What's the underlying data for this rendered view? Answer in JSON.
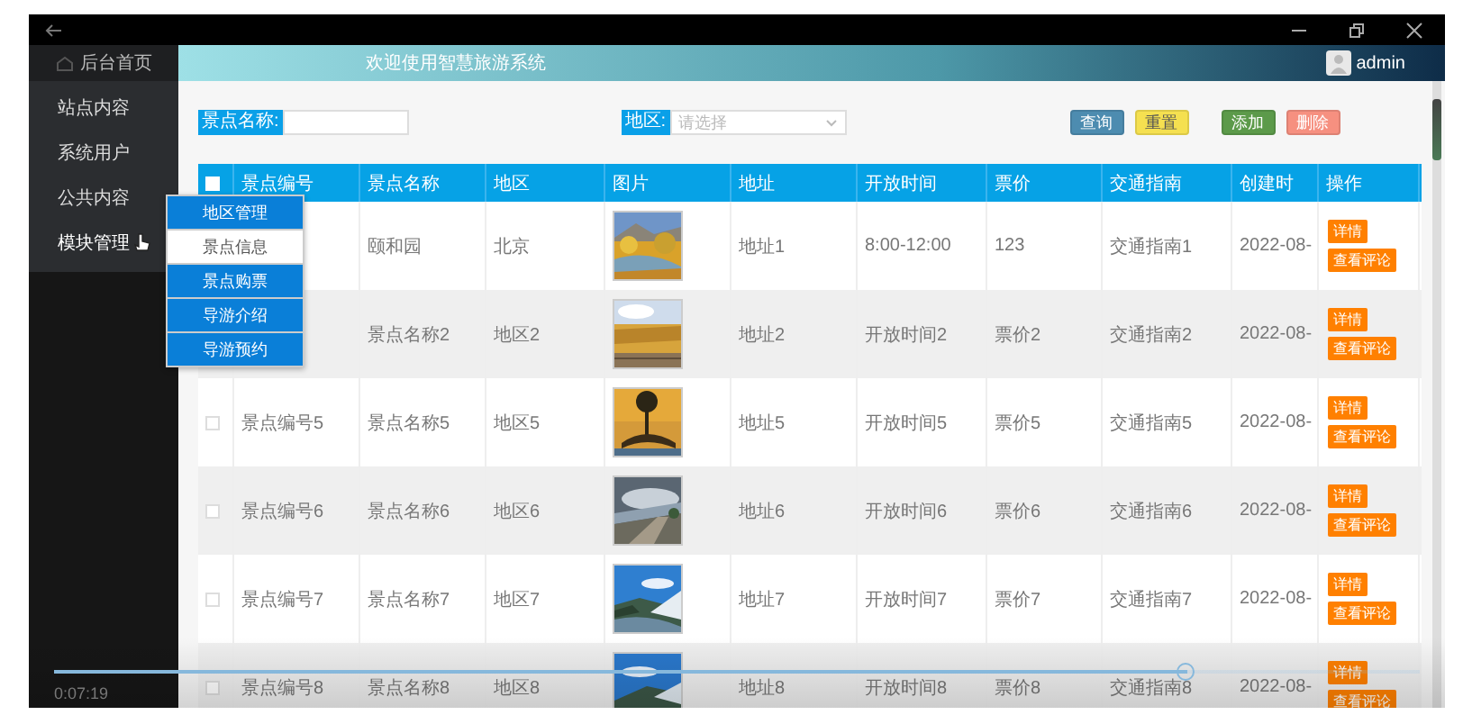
{
  "sidebar": {
    "home": "后台首页",
    "items": [
      {
        "label": "站点内容",
        "hovered": false
      },
      {
        "label": "系统用户",
        "hovered": false
      },
      {
        "label": "公共内容",
        "hovered": false
      },
      {
        "label": "模块管理",
        "hovered": true
      }
    ]
  },
  "header": {
    "title": "欢迎使用智慧旅游系统",
    "user": "admin"
  },
  "search": {
    "name_label": "景点名称:",
    "region_label": "地区:",
    "region_placeholder": "请选择",
    "buttons": [
      {
        "label": "查询",
        "kind": "query"
      },
      {
        "label": "重置",
        "kind": "reset"
      },
      {
        "label": "添加",
        "kind": "add"
      },
      {
        "label": "删除",
        "kind": "delete"
      }
    ]
  },
  "table": {
    "columns": [
      "景点编号",
      "景点名称",
      "地区",
      "图片",
      "地址",
      "开放时间",
      "票价",
      "交通指南",
      "创建时",
      "操作"
    ],
    "header_checked": false,
    "rows": [
      {
        "name": "颐和园",
        "region": "北京",
        "address": "地址1",
        "hours": "8:00-12:00",
        "price": "123",
        "guide": "交通指南1",
        "created": "2022-08-",
        "actions": [
          "详情",
          "查看评论"
        ]
      },
      {
        "name": "景点名称2",
        "region": "地区2",
        "address": "地址2",
        "hours": "开放时间2",
        "price": "票价2",
        "guide": "交通指南2",
        "created": "2022-08-",
        "actions": [
          "详情",
          "查看评论"
        ]
      },
      {
        "checked": false,
        "id": "景点编号5",
        "name": "景点名称5",
        "region": "地区5",
        "address": "地址5",
        "hours": "开放时间5",
        "price": "票价5",
        "guide": "交通指南5",
        "created": "2022-08-",
        "actions": [
          "详情",
          "查看评论"
        ]
      },
      {
        "checked": false,
        "id": "景点编号6",
        "name": "景点名称6",
        "region": "地区6",
        "address": "地址6",
        "hours": "开放时间6",
        "price": "票价6",
        "guide": "交通指南6",
        "created": "2022-08-",
        "actions": [
          "详情",
          "查看评论"
        ]
      },
      {
        "checked": false,
        "id": "景点编号7",
        "name": "景点名称7",
        "region": "地区7",
        "address": "地址7",
        "hours": "开放时间7",
        "price": "票价7",
        "guide": "交通指南7",
        "created": "2022-08-",
        "actions": [
          "详情",
          "查看评论"
        ]
      },
      {
        "checked": false,
        "id": "景点编号8",
        "name": "景点名称8",
        "region": "地区8",
        "address": "地址8",
        "hours": "开放时间8",
        "price": "票价8",
        "guide": "交通指南8",
        "created": "2022-08-",
        "actions": [
          "详情",
          "查看评论"
        ]
      }
    ]
  },
  "submenu": {
    "items": [
      {
        "label": "地区管理",
        "selected": false
      },
      {
        "label": "景点信息",
        "selected": true
      },
      {
        "label": "景点购票",
        "selected": false
      },
      {
        "label": "导游介绍",
        "selected": false
      },
      {
        "label": "导游预约",
        "selected": false
      }
    ]
  },
  "player": {
    "time": "0:07:19",
    "level": 0.83
  }
}
